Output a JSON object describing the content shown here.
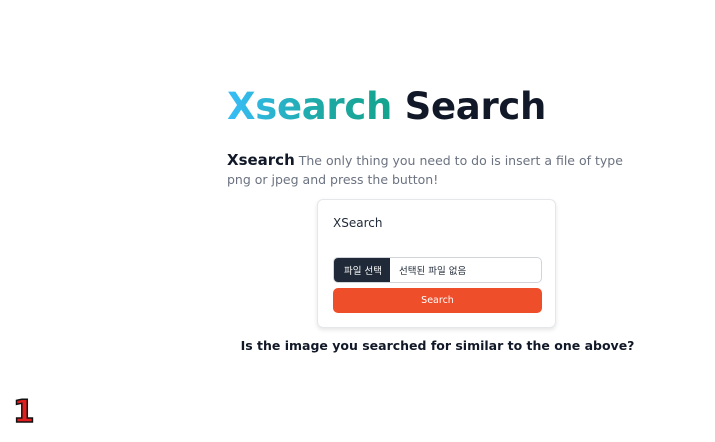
{
  "hero": {
    "brand": "Xsearch",
    "title_rest": "Search"
  },
  "intro": {
    "brand": "Xsearch",
    "text": "The only thing you need to do is insert a file of type png or jpeg and press the button!"
  },
  "card": {
    "title": "XSearch",
    "file_button_label": "파일 선택",
    "file_status": "선택된 파일 없음",
    "search_button_label": "Search"
  },
  "feedback": {
    "question": "Is the image you searched for similar to the one above?"
  },
  "page_counter": "1",
  "colors": {
    "brand_gradient_start": "#38bdf8",
    "brand_gradient_end": "#14a38e",
    "search_button": "#ef4e2a",
    "file_button": "#1f2937",
    "counter": "#e11d1d"
  }
}
